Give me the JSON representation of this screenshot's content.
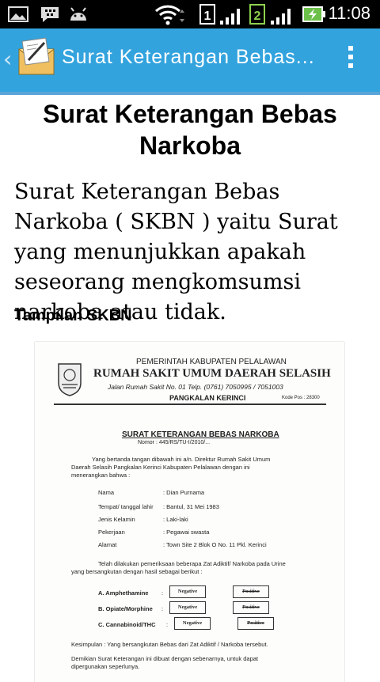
{
  "status_bar": {
    "time": "11:08",
    "icons": [
      "image-icon",
      "bbm-icon",
      "android-icon",
      "wifi-icon",
      "sim1-icon",
      "signal1-icon",
      "sim2-icon",
      "signal2-icon",
      "battery-charging-icon"
    ],
    "sim1_label": "1",
    "sim2_label": "2"
  },
  "action_bar": {
    "title": "Surat Keterangan Bebas..."
  },
  "article": {
    "title": "Surat Keterangan Bebas Narkoba",
    "lead": "Surat Keterangan Bebas Narkoba ( SKBN ) yaitu Surat yang menunjukkan apakah seseorang mengkomsumsi narkoba atau tidak.",
    "subheading": "Tampilan SKBN"
  },
  "document": {
    "header1": "PEMERINTAH KABUPATEN PELALAWAN",
    "header2": "RUMAH SAKIT UMUM DAERAH SELASIH",
    "address": "Jalan Rumah Sakit No. 01 Telp. (0761) 7050995 / 7051003",
    "city": "PANGKALAN KERINCI",
    "postcode": "Kode Pos : 28300",
    "doc_title": "SURAT KETERANGAN BEBAS NARKOBA",
    "number": "Nomor : 445/RS/TU-I/2010/...",
    "intro": [
      "Yang bertanda tangan dibawah ini a/n. Direktur Rumah Sakit Umum",
      "Daerah Selasih Pangkalan Kerinci Kabupaten Pelalawan dengan ini",
      "menerangkan bahwa :"
    ],
    "fields": [
      {
        "label": "Nama",
        "value": ": Dian Purnama"
      },
      {
        "label": "Tempat/ tanggal lahir",
        "value": ": Bantul, 31 Mei 1983"
      },
      {
        "label": "Jenis Kelamin",
        "value": ": Laki-laki"
      },
      {
        "label": "Pekerjaan",
        "value": ": Pegawai swasta"
      },
      {
        "label": "Alamat",
        "value": ": Town Site 2 Blok O No. 11 Pkl. Kerinci"
      }
    ],
    "exam": [
      "Telah dilakukan pemeriksaan beberapa Zat Adiktif/ Narkoba pada Urine",
      "yang bersangkutan dengan hasil sebagai berikut :"
    ],
    "tests": [
      {
        "name": "A. Amphethamine",
        "colon": ":",
        "negative": "Negative",
        "positive": "Positive"
      },
      {
        "name": "B. Opiate/Morphine",
        "colon": ":",
        "negative": "Negative",
        "positive": "Positive"
      },
      {
        "name": "C. Cannabinoid/THC",
        "colon": ":",
        "negative": "Negative",
        "positive": "Positive"
      }
    ],
    "conclusion": "Kesimpulan : Yang bersangkutan Bebas dari Zat Adiktif / Narkoba tersebut.",
    "closing": [
      "Demikian Surat Keterangan ini dibuat dengan sebenarnya, untuk dapat",
      "dipergunakan seperlunya."
    ]
  }
}
